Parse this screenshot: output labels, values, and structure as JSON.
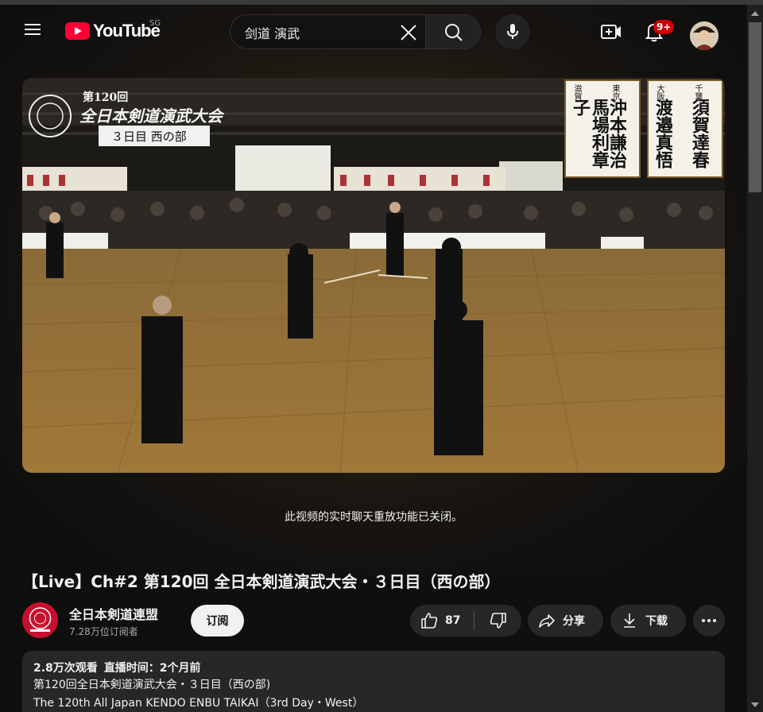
{
  "header": {
    "logo_text": "YouTube",
    "region": "SG",
    "search_value": "剑道 演武",
    "notification_badge": "9+"
  },
  "player": {
    "overlay_edition": "第120回",
    "overlay_title": "全日本剣道演武大会",
    "overlay_day": "３日目 西の部",
    "name_card_left": [
      "滋賀",
      "東京",
      "馬場利章子",
      "沖本謙治"
    ],
    "name_card_right": [
      "大阪",
      "千葉",
      "渡邉真悟",
      "須賀達春"
    ]
  },
  "chat_notice": "此视频的实时聊天重放功能已关闭。",
  "video": {
    "title": "【Live】Ch#2 第120回 全日本剣道演武大会・３日目（西の部）"
  },
  "channel": {
    "name": "全日本剣道連盟",
    "subscribers": "7.28万位订阅者",
    "subscribe_label": "订阅"
  },
  "actions": {
    "like_count": "87",
    "share_label": "分享",
    "download_label": "下载"
  },
  "description": {
    "views": "2.8万次观看",
    "streamed": "直播时间：2个月前",
    "lines": [
      "第120回全日本剣道演武大会・３日目（西の部)",
      "The 120th All Japan KENDO ENBU TAIKAI（3rd Day・West）"
    ]
  },
  "colors": {
    "background": "#0f0f0f",
    "brand_red": "#ff0033",
    "badge_red": "#cc0000",
    "pill_bg": "#272727"
  }
}
